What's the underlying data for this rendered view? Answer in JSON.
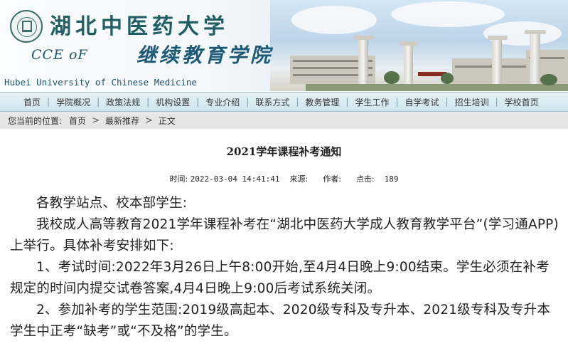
{
  "header": {
    "university_cn": "湖北中医药大学",
    "cce": "CCE oF",
    "college_cn": "继续教育学院",
    "university_en": "Hubei University of Chinese Medicine"
  },
  "nav": {
    "items": [
      "首页",
      "学院概况",
      "政策法规",
      "机构设置",
      "专业介绍",
      "联系方式",
      "教务管理",
      "学生工作",
      "自学考试",
      "招生培训",
      "学校首页"
    ],
    "separator": "|"
  },
  "breadcrumb": {
    "label": "您当前的位置:",
    "items": [
      "首页",
      "最新推荐",
      "正文"
    ],
    "separator": ">"
  },
  "article": {
    "title": "2021学年课程补考通知",
    "meta": {
      "time_label": "时间:",
      "time_value": "2022-03-04 14:41:41",
      "source_label": "来源:",
      "author_label": "作者:",
      "clicks_label": "点击:",
      "clicks_value": "189"
    },
    "paragraphs": [
      "各教学站点、校本部学生:",
      "我校成人高等教育2021学年课程补考在“湖北中医药大学成人教育教学平台”(学习通APP)上举行。具体补考安排如下:",
      "1、考试时间:2022年3月26日上午8:00开始,至4月4日晚上9:00结束。学生必须在补考规定的时间内提交试卷答案,4月4日晚上9:00后考试系统关闭。",
      "2、参加补考的学生范围:2019级高起本、2020级专科及专升本、2021级专科及专升本学生中正考“缺考”或“不及格”的学生。"
    ]
  }
}
